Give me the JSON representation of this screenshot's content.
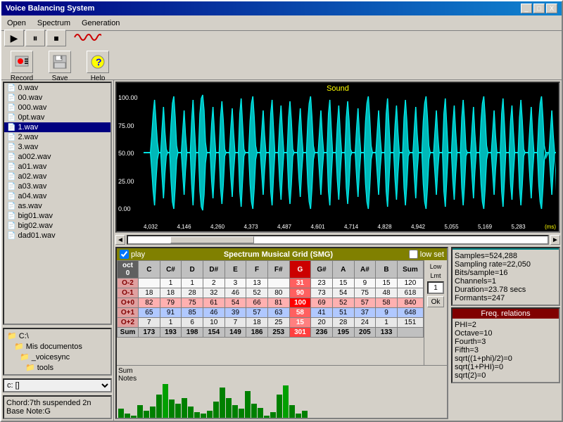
{
  "window": {
    "title": "Voice Balancing System",
    "controls": [
      "_",
      "□",
      "X"
    ]
  },
  "menu": {
    "items": [
      "Open",
      "Spectrum",
      "Generation"
    ]
  },
  "toolbar": {
    "playback_buttons": [
      "▶",
      "⏸",
      "⏹"
    ],
    "record_label": "Record",
    "save_label": "Save",
    "help_label": "Help"
  },
  "file_list": {
    "items": [
      "0.wav",
      "00.wav",
      "000.wav",
      "0pt.wav",
      "1.wav",
      "2.wav",
      "3.wav",
      "a002.wav",
      "a01.wav",
      "a02.wav",
      "a03.wav",
      "a04.wav",
      "as.wav",
      "big01.wav",
      "big02.wav",
      "dad01.wav"
    ],
    "selected": "1.wav"
  },
  "folders": {
    "items": [
      "C:\\",
      "Mis documentos",
      "_voicesync",
      "tools"
    ]
  },
  "drive": "c: []",
  "chord_info": {
    "line1": "Chord:7th suspended 2n",
    "line2": "Base Note:G"
  },
  "waveform": {
    "title": "Sound",
    "y_labels": [
      "100.00",
      "75.00",
      "50.00",
      "25.00",
      "0.00"
    ],
    "x_labels": [
      "4,032",
      "4,146",
      "4,260",
      "4,373",
      "4,487",
      "4,601",
      "4,714",
      "4,828",
      "4,942",
      "5,055",
      "5,169",
      "5,283"
    ],
    "unit": "(ms)"
  },
  "smg": {
    "title": "Spectrum Musical Grid  (SMG)",
    "play_checked": true,
    "low_set": "low set",
    "low_lmt_label": "Low Lmt",
    "low_value": "1",
    "ok_label": "Ok",
    "columns": [
      "",
      "C",
      "C#",
      "D",
      "D#",
      "E",
      "F",
      "F#",
      "G",
      "G#",
      "A",
      "A#",
      "B",
      "Sum"
    ],
    "rows": [
      {
        "oct": "O-2",
        "class": "row-0-2",
        "vals": [
          1,
          1,
          2,
          3,
          13,
          31,
          23,
          15,
          9,
          15,
          120
        ]
      },
      {
        "oct": "O-1",
        "class": "row-0-1",
        "vals": [
          18,
          18,
          28,
          32,
          46,
          52,
          80,
          90,
          73,
          54,
          75,
          48,
          618
        ]
      },
      {
        "oct": "O+0",
        "class": "row-0",
        "vals": [
          82,
          79,
          75,
          61,
          54,
          66,
          81,
          100,
          69,
          52,
          57,
          58,
          840
        ]
      },
      {
        "oct": "O+1",
        "class": "row-1",
        "vals": [
          65,
          91,
          85,
          46,
          39,
          57,
          63,
          58,
          41,
          51,
          37,
          9,
          648
        ]
      },
      {
        "oct": "O+2",
        "class": "row-2",
        "vals": [
          7,
          1,
          6,
          10,
          7,
          18,
          25,
          15,
          20,
          28,
          24,
          1,
          151
        ]
      },
      {
        "oct": "Sum",
        "class": "row-sum",
        "vals": [
          173,
          193,
          198,
          154,
          149,
          186,
          253,
          301,
          236,
          195,
          205,
          133
        ]
      }
    ],
    "all_notes": [
      "C",
      "C#",
      "D",
      "D#",
      "E",
      "F",
      "F#",
      "G",
      "G#",
      "A",
      "A#",
      "B"
    ]
  },
  "info": {
    "title": "",
    "samples": "Samples=524,288",
    "sampling_rate": "Sampling rate=22,050",
    "bits": "Bits/sample=16",
    "channels": "Channels=1",
    "duration": "Duration=23.78 secs",
    "formants": "Formants=247"
  },
  "freq": {
    "title": "Freq. relations",
    "phi": "PHI=2",
    "octave": "Octave=10",
    "fourth": "Fourth=3",
    "fifth": "Fifth=3",
    "sqrt1": "sqrt((1+phi)/2)=0",
    "sqrt2": "sqrt(1+PHI)=0",
    "sqrt3": "sqrt(2)=0"
  },
  "sum_notes": {
    "label": "Sum Notes",
    "bars": [
      15,
      8,
      5,
      20,
      12,
      18,
      35,
      70,
      28,
      22,
      30,
      18,
      10,
      8,
      12,
      25,
      45,
      30,
      20,
      15
    ]
  }
}
